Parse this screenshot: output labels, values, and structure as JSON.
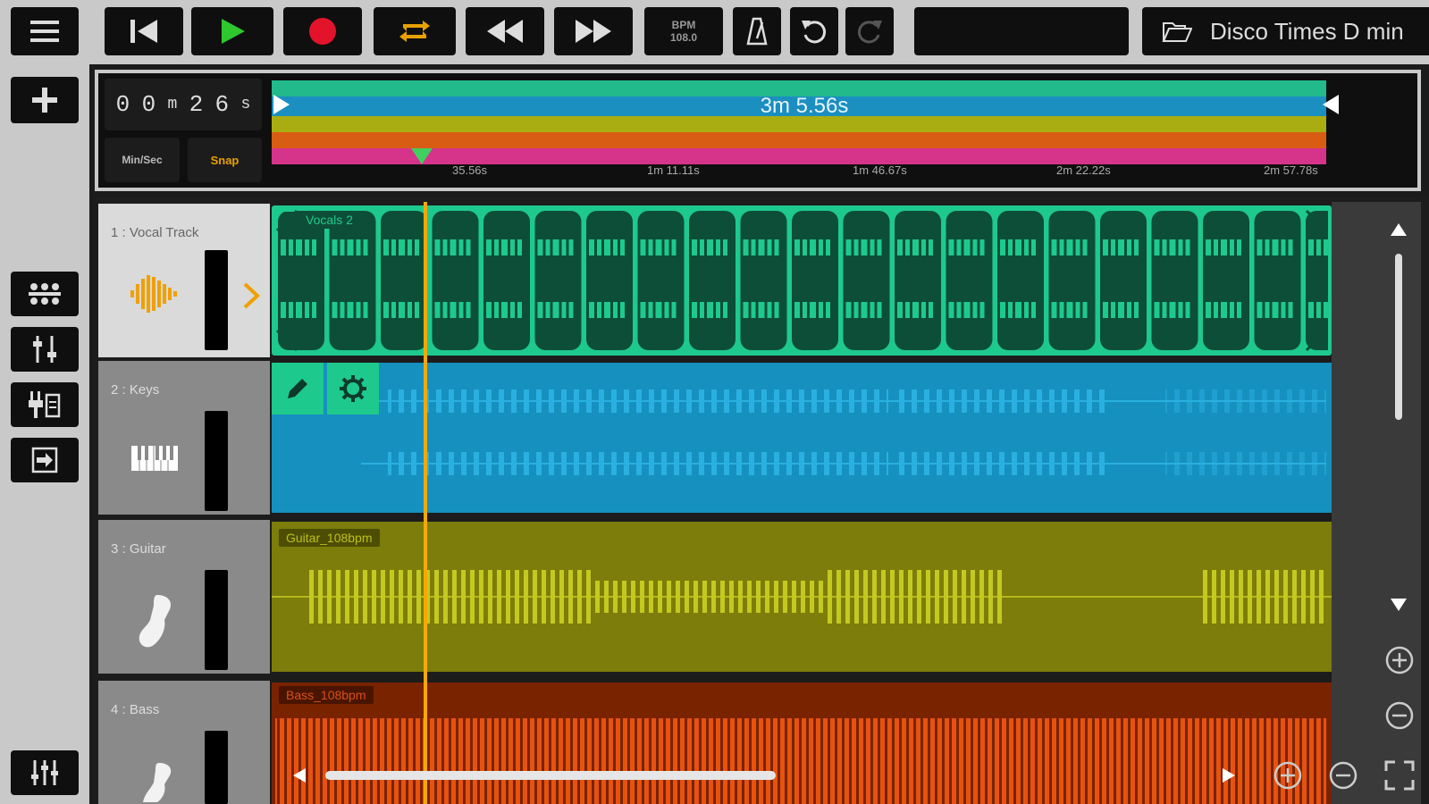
{
  "toolbar": {
    "project_label": "Disco Times D min",
    "bpm_title": "BPM",
    "bpm_value": "108.0"
  },
  "timeline": {
    "position": [
      "0",
      "0",
      "m",
      "2",
      "6",
      "s"
    ],
    "time_format_label": "Min/Sec",
    "snap_label": "Snap",
    "loop_length": "3m 5.56s",
    "ticks": [
      "35.56s",
      "1m 11.11s",
      "1m 46.67s",
      "2m 22.22s",
      "2m 57.78s"
    ]
  },
  "tracks": [
    {
      "label": "1 : Vocal Track",
      "clip": "Vocals 2",
      "icon": "waveform-icon"
    },
    {
      "label": "2 : Keys",
      "clip": "",
      "icon": "piano-icon"
    },
    {
      "label": "3 : Guitar",
      "clip": "Guitar_108bpm",
      "icon": "guitar-icon"
    },
    {
      "label": "4 : Bass",
      "clip": "Bass_108bpm",
      "icon": "bass-icon"
    }
  ],
  "colors": {
    "vocal": "#1ec98e",
    "vocal_dark": "#0d4e39",
    "keys": "#1590bf",
    "guitar": "#7c7d0a",
    "bass": "#7a2300",
    "playhead": "#f7a800",
    "snap_text": "#e8a000"
  }
}
